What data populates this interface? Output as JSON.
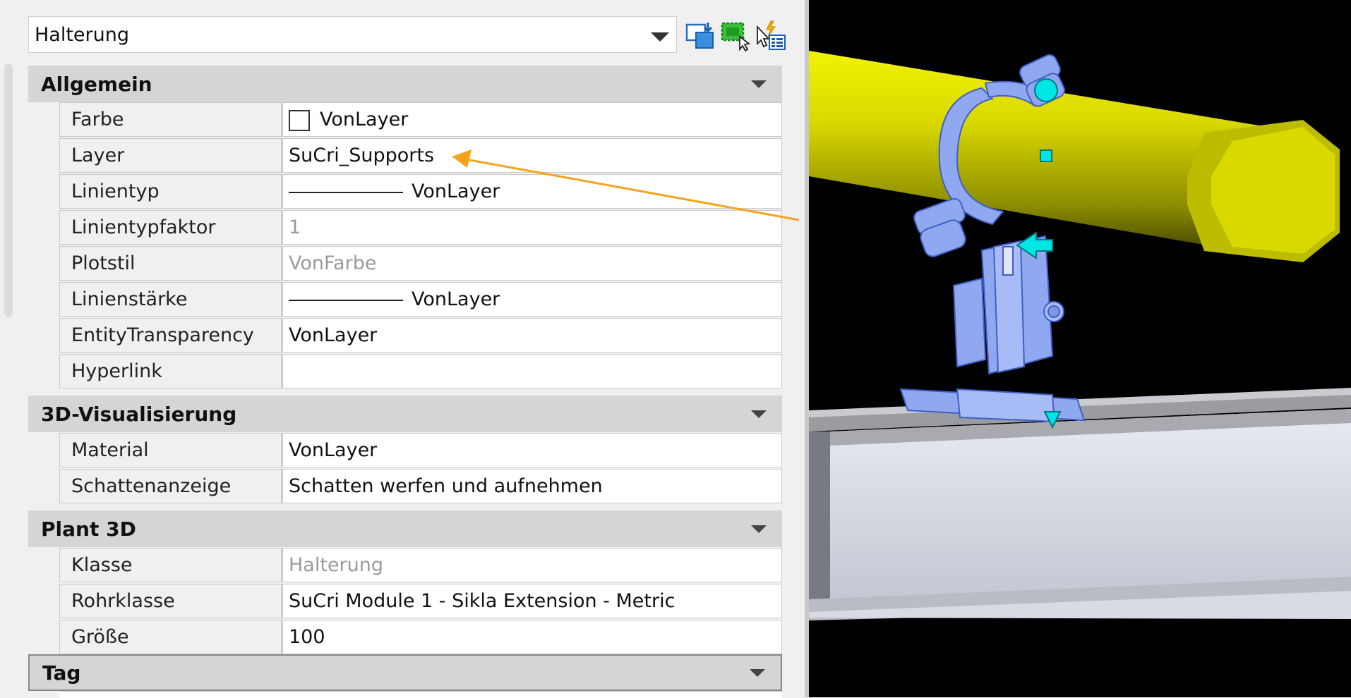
{
  "selector": {
    "value": "Halterung"
  },
  "toolbar": {
    "icons": [
      "toggle-pickadd-icon",
      "select-objects-icon",
      "quick-select-icon"
    ]
  },
  "sections": {
    "allgemein": {
      "title": "Allgemein",
      "rows": [
        {
          "name": "Farbe",
          "value": "VonLayer"
        },
        {
          "name": "Layer",
          "value": "SuCri_Supports"
        },
        {
          "name": "Linientyp",
          "value": "VonLayer"
        },
        {
          "name": "Linientypfaktor",
          "value": "1"
        },
        {
          "name": "Plotstil",
          "value": "VonFarbe"
        },
        {
          "name": "Linienstärke",
          "value": "VonLayer"
        },
        {
          "name": "EntityTransparency",
          "value": "VonLayer"
        },
        {
          "name": "Hyperlink",
          "value": ""
        }
      ]
    },
    "visualisierung": {
      "title": "3D-Visualisierung",
      "rows": [
        {
          "name": "Material",
          "value": "VonLayer"
        },
        {
          "name": "Schattenanzeige",
          "value": "Schatten werfen und aufnehmen"
        }
      ]
    },
    "plant": {
      "title": "Plant 3D",
      "rows": [
        {
          "name": "Klasse",
          "value": "Halterung"
        },
        {
          "name": "Rohrklasse",
          "value": "SuCri Module 1 - Sikla Extension - Metric"
        },
        {
          "name": "Größe",
          "value": "100"
        }
      ]
    },
    "tag": {
      "title": "Tag"
    }
  },
  "colors": {
    "pipe": "#d4d400",
    "support": "#8fa8f0",
    "arrow": "#f4a31c",
    "grip": "#00e5e5"
  }
}
